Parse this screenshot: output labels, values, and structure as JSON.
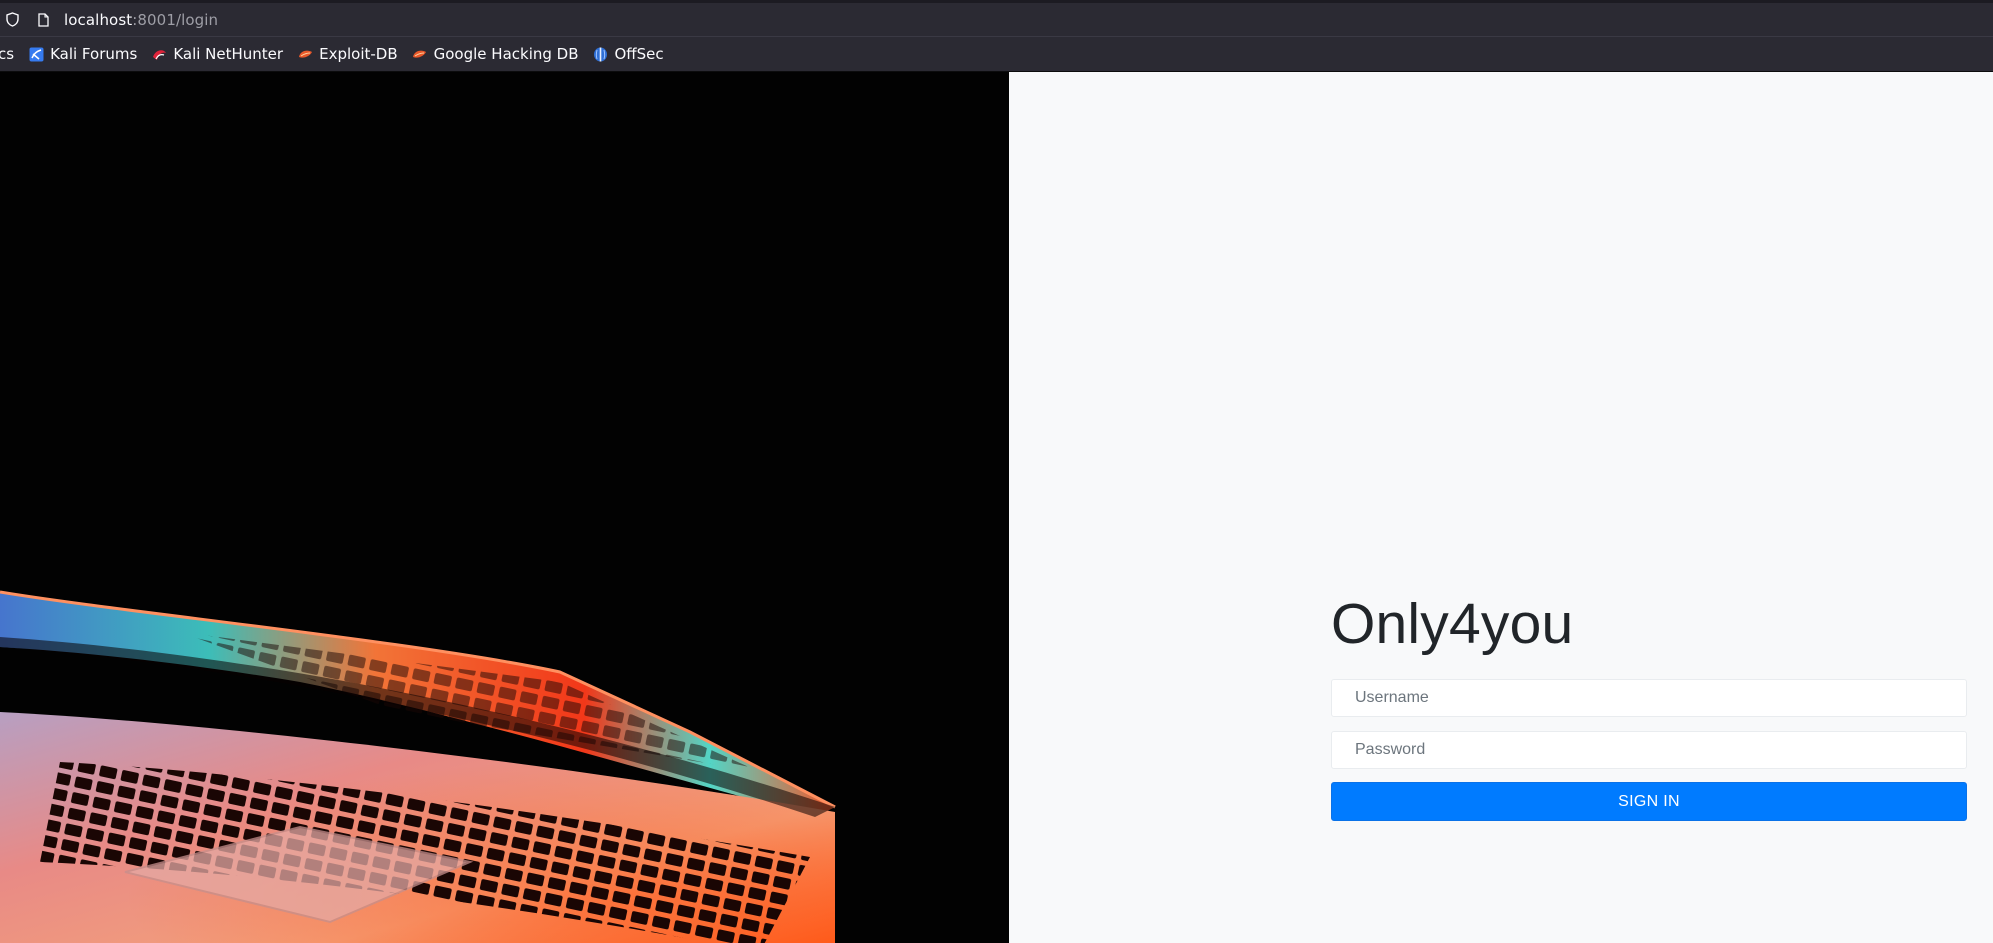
{
  "browser": {
    "url_host": "localhost",
    "url_path": ":8001/login",
    "bookmarks": [
      {
        "label": "cs",
        "icon": "bookmark-icon"
      },
      {
        "label": "Kali Forums",
        "icon": "kali-forums-icon"
      },
      {
        "label": "Kali NetHunter",
        "icon": "kali-nethunter-icon"
      },
      {
        "label": "Exploit-DB",
        "icon": "exploit-db-icon"
      },
      {
        "label": "Google Hacking DB",
        "icon": "exploit-db-icon"
      },
      {
        "label": "OffSec",
        "icon": "offsec-icon"
      }
    ]
  },
  "login": {
    "title": "Only4you",
    "username_placeholder": "Username",
    "password_placeholder": "Password",
    "submit_label": "SIGN IN"
  },
  "colors": {
    "accent": "#007bff",
    "page_bg": "#f8f9fa",
    "chrome_bg": "#2b2a33"
  }
}
